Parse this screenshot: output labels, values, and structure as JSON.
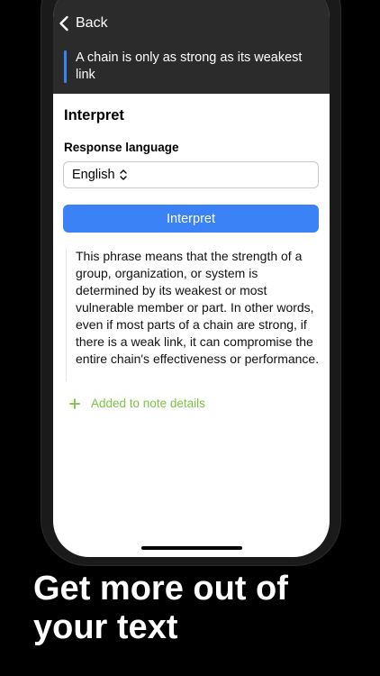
{
  "nav": {
    "back_label": "Back"
  },
  "quote": {
    "text": "A chain is only as strong as its weakest link"
  },
  "interpret": {
    "section_title": "Interpret",
    "language_label": "Response language",
    "language_value": "English",
    "button_label": "Interpret"
  },
  "result": {
    "text": "This phrase means that the strength of a group, organization, or system is determined by its weakest or most vulnerable member or part. In other words, even if most parts of a chain are strong, if there is a weak link, it can compromise the entire chain's effectiveness or performance.",
    "added_label": "Added to note details"
  },
  "marketing": {
    "tagline": "Get more out of your text"
  },
  "colors": {
    "accent": "#3b82f6",
    "success": "#7cc243",
    "header_bg": "#2b2b2b"
  },
  "icons": {
    "back": "chevron-left-icon",
    "select": "chevron-up-down-icon",
    "added": "plus-icon"
  }
}
